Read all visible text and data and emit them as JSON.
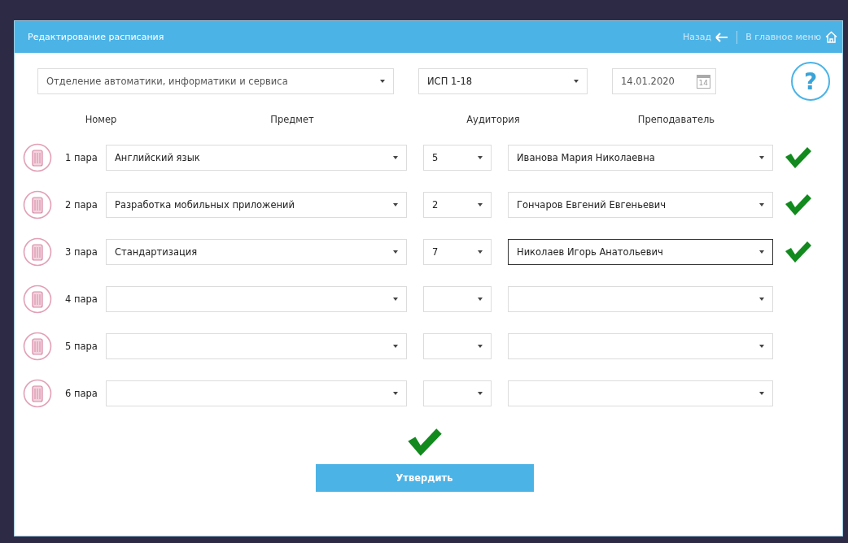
{
  "window": {
    "title": "Редактирование расписания",
    "nav": [
      {
        "label": "Назад",
        "kind": "back"
      },
      {
        "label": "В главное меню",
        "kind": "home"
      }
    ]
  },
  "filters": {
    "department": "Отделение автоматики, информатики и сервиса",
    "group": "ИСП 1-18",
    "date": "14.01.2020",
    "calendar_day": "14",
    "help": "?"
  },
  "columns": [
    "Номер",
    "Предмет",
    "Аудитория",
    "Преподаватель"
  ],
  "rows": [
    {
      "number": "1 пара",
      "subject": "Английский язык",
      "room": "5",
      "teacher": "Иванова Мария Николаевна",
      "confirmed": true,
      "focused": false
    },
    {
      "number": "2 пара",
      "subject": "Разработка мобильных приложений",
      "room": "2",
      "teacher": "Гончаров Евгений Евгеньевич",
      "confirmed": true,
      "focused": false
    },
    {
      "number": "3 пара",
      "subject": "Стандартизация",
      "room": "7",
      "teacher": "Николаев Игорь Анатольевич",
      "confirmed": true,
      "focused": true
    },
    {
      "number": "4 пара",
      "confirmed": false,
      "focused": false
    },
    {
      "number": "5 пара",
      "confirmed": false,
      "focused": false
    },
    {
      "number": "6 пара",
      "confirmed": false,
      "focused": false
    }
  ],
  "submit": {
    "label": "Утвердить",
    "confirmed": true
  }
}
